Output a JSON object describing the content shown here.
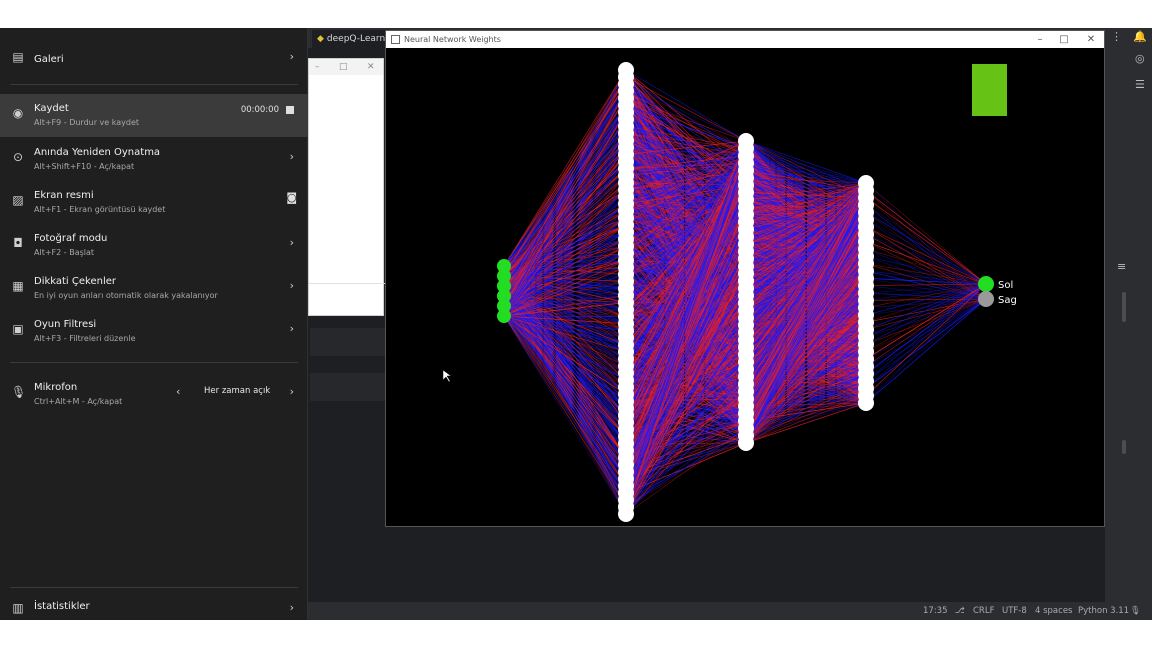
{
  "ide": {
    "tab_label": "deepQ-Learni",
    "status": {
      "position": "17:35",
      "line_endings": "CRLF",
      "encoding": "UTF-8",
      "indent": "4 spaces",
      "interpreter": "Python 3.11"
    }
  },
  "gamebar": {
    "gallery": {
      "title": "Galeri",
      "icon": "gallery-icon"
    },
    "record": {
      "title": "Kaydet",
      "sub": "Alt+F9 - Durdur ve kaydet",
      "time": "00:00:00",
      "icon": "record-icon"
    },
    "instant_replay": {
      "title": "Anında Yeniden Oynatma",
      "sub": "Alt+Shift+F10 - Aç/kapat",
      "icon": "replay-icon"
    },
    "screenshot": {
      "title": "Ekran resmi",
      "sub": "Alt+F1 - Ekran görüntüsü kaydet",
      "icon": "image-icon"
    },
    "photo_mode": {
      "title": "Fotoğraf modu",
      "sub": "Alt+F2 - Başlat",
      "icon": "camera-icon"
    },
    "highlights": {
      "title": "Dikkati Çekenler",
      "sub": "En iyi oyun anları otomatik olarak yakalanıyor",
      "icon": "clapper-icon"
    },
    "game_filters": {
      "title": "Oyun Filtresi",
      "sub": "Alt+F3 - Filtreleri düzenle",
      "icon": "filter-icon"
    },
    "microphone": {
      "title": "Mikrofon",
      "sub": "Ctrl+Alt+M - Aç/kapat",
      "value": "Her zaman açık",
      "icon": "microphone-icon"
    },
    "statistics": {
      "title": "İstatistikler",
      "icon": "stats-icon"
    }
  },
  "nn_window": {
    "title": "Neural Network Weights",
    "colors": {
      "positive": "#1a1aff",
      "negative": "#e0202a",
      "active": "#22dd22",
      "inactive": "#9a9a9a",
      "neuron": "#ffffff",
      "action_indicator": "#66c214"
    },
    "network": {
      "layers": [
        {
          "name": "input",
          "size": 6,
          "color": "#22dd22"
        },
        {
          "name": "hidden1",
          "size": 64,
          "color": "#ffffff"
        },
        {
          "name": "hidden2",
          "size": 42,
          "color": "#ffffff"
        },
        {
          "name": "hidden3",
          "size": 31,
          "color": "#ffffff"
        },
        {
          "name": "output",
          "size": 2
        }
      ],
      "outputs": [
        {
          "label": "Sol",
          "active": true
        },
        {
          "label": "Sag",
          "active": false
        }
      ]
    }
  }
}
